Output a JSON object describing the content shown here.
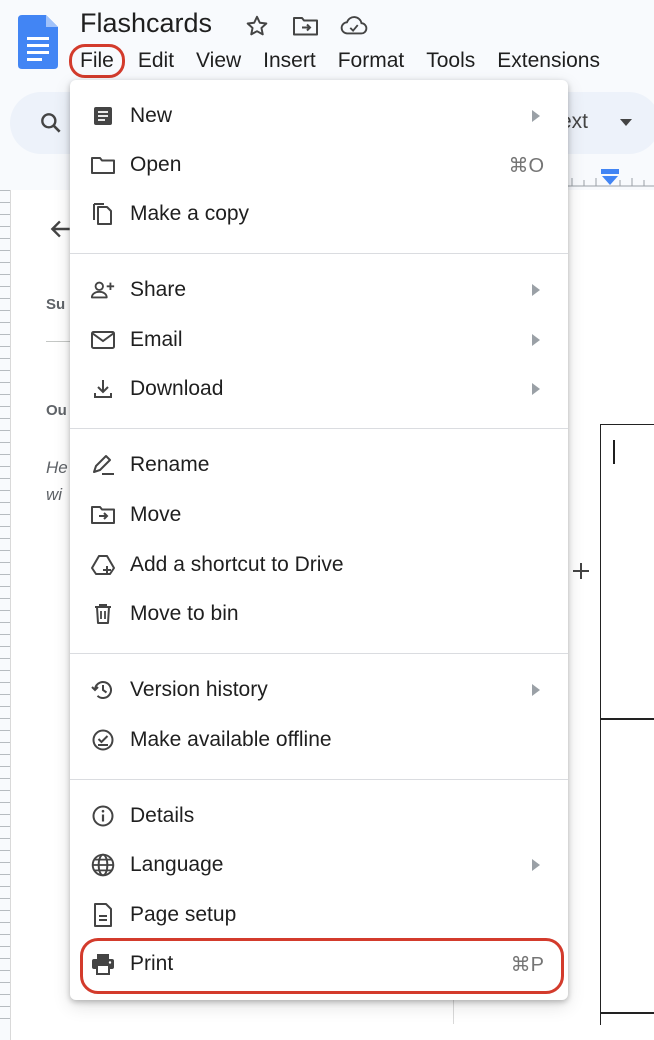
{
  "document": {
    "title": "Flashcards"
  },
  "menubar": {
    "items": [
      "File",
      "Edit",
      "View",
      "Insert",
      "Format",
      "Tools",
      "Extensions"
    ],
    "active": "File"
  },
  "toolbar": {
    "style_text": "ext"
  },
  "outline": {
    "summary_hint": "Su",
    "outline_hint": "Ou",
    "italic_line1": "He",
    "italic_line2": "wi"
  },
  "file_menu": {
    "items": [
      {
        "label": "New",
        "icon": "document-icon",
        "submenu": true
      },
      {
        "label": "Open",
        "icon": "folder-icon",
        "shortcut": "⌘O"
      },
      {
        "label": "Make a copy",
        "icon": "copy-icon"
      },
      {
        "label": "Share",
        "icon": "person-add-icon",
        "submenu": true
      },
      {
        "label": "Email",
        "icon": "mail-icon",
        "submenu": true
      },
      {
        "label": "Download",
        "icon": "download-icon",
        "submenu": true
      },
      {
        "label": "Rename",
        "icon": "edit-icon"
      },
      {
        "label": "Move",
        "icon": "move-folder-icon"
      },
      {
        "label": "Add a shortcut to Drive",
        "icon": "drive-shortcut-icon"
      },
      {
        "label": "Move to bin",
        "icon": "trash-icon"
      },
      {
        "label": "Version history",
        "icon": "history-icon",
        "submenu": true
      },
      {
        "label": "Make available offline",
        "icon": "offline-check-icon"
      },
      {
        "label": "Details",
        "icon": "info-icon"
      },
      {
        "label": "Language",
        "icon": "globe-icon",
        "submenu": true
      },
      {
        "label": "Page setup",
        "icon": "page-icon"
      },
      {
        "label": "Print",
        "icon": "printer-icon",
        "shortcut": "⌘P"
      }
    ]
  },
  "colors": {
    "highlight": "#d33b2c",
    "docs_blue": "#4285f4",
    "toolbar_bg": "#edf2fa"
  }
}
